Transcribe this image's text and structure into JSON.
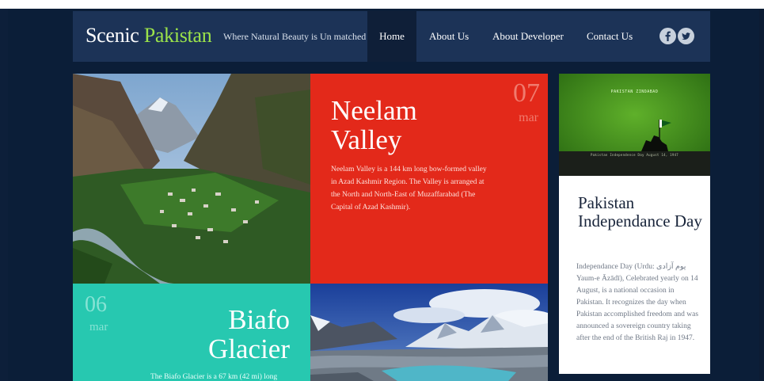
{
  "header": {
    "logo_main": "Scenic",
    "logo_accent": "Pakistan",
    "tagline": "Where Natural Beauty is Un matched",
    "nav": [
      {
        "label": "Home"
      },
      {
        "label": "About Us"
      },
      {
        "label": "About Developer"
      },
      {
        "label": "Contact Us"
      }
    ],
    "social": [
      {
        "icon": "facebook-icon"
      },
      {
        "icon": "twitter-icon"
      }
    ]
  },
  "neelam": {
    "title": "Neelam Valley",
    "day": "07",
    "month": "mar",
    "body": "Neelam Valley is a 144 km long bow-formed valley in Azad Kashmir Region. The Valley is arranged at the North and North-East of Muzaffarabad (The Capital of Azad Kashmir)."
  },
  "biafo": {
    "title": "Biafo Glacier",
    "day": "06",
    "month": "mar",
    "body": "The Biafo Glacier is a 67 km (42 mi) long"
  },
  "independence": {
    "banner_text": "PAKISTAN ZINDABAD",
    "banner_caption": "Pakistan Independence Day August 14, 1947",
    "title": "Pakistan Independance Day",
    "body": "Independance Day (Urdu: یوم آزادی Yaum-e Āzādī), Celebrated yearly on 14 August, is a national occasion in Pakistan. It recognizes the day when Pakistan accomplished freedom and was announced a sovereign country taking after the end of the British Raj in 1947."
  },
  "colors": {
    "page_bg": "#0b1e38",
    "header_bg": "#1c3357",
    "accent_green": "#9be34a",
    "red_tile": "#e3291a",
    "teal_tile": "#27c8b0"
  }
}
